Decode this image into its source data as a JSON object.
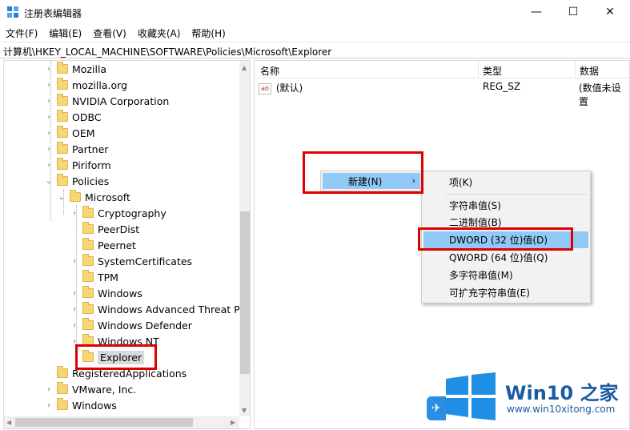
{
  "window": {
    "title": "注册表编辑器",
    "minimize_glyph": "—",
    "maximize_glyph": "☐",
    "close_glyph": "✕"
  },
  "menu": [
    "文件(F)",
    "编辑(E)",
    "查看(V)",
    "收藏夹(A)",
    "帮助(H)"
  ],
  "address": "计算机\\HKEY_LOCAL_MACHINE\\SOFTWARE\\Policies\\Microsoft\\Explorer",
  "tree": [
    {
      "label": "Mozilla",
      "level": 0,
      "expander": "collapsed"
    },
    {
      "label": "mozilla.org",
      "level": 0,
      "expander": "collapsed"
    },
    {
      "label": "NVIDIA Corporation",
      "level": 0,
      "expander": "collapsed"
    },
    {
      "label": "ODBC",
      "level": 0,
      "expander": "collapsed"
    },
    {
      "label": "OEM",
      "level": 0,
      "expander": "collapsed"
    },
    {
      "label": "Partner",
      "level": 0,
      "expander": "collapsed"
    },
    {
      "label": "Piriform",
      "level": 0,
      "expander": "collapsed"
    },
    {
      "label": "Policies",
      "level": 0,
      "expander": "expanded"
    },
    {
      "label": "Microsoft",
      "level": 1,
      "expander": "expanded"
    },
    {
      "label": "Cryptography",
      "level": 2,
      "expander": "collapsed"
    },
    {
      "label": "PeerDist",
      "level": 2,
      "expander": "none"
    },
    {
      "label": "Peernet",
      "level": 2,
      "expander": "none"
    },
    {
      "label": "SystemCertificates",
      "level": 2,
      "expander": "collapsed"
    },
    {
      "label": "TPM",
      "level": 2,
      "expander": "none"
    },
    {
      "label": "Windows",
      "level": 2,
      "expander": "collapsed"
    },
    {
      "label": "Windows Advanced Threat Pr",
      "level": 2,
      "expander": "collapsed"
    },
    {
      "label": "Windows Defender",
      "level": 2,
      "expander": "collapsed"
    },
    {
      "label": "Windows NT",
      "level": 2,
      "expander": "collapsed"
    },
    {
      "label": "Explorer",
      "level": 2,
      "expander": "none",
      "selected": true
    },
    {
      "label": "RegisteredApplications",
      "level": 0,
      "expander": "none"
    },
    {
      "label": "VMware, Inc.",
      "level": 0,
      "expander": "collapsed"
    },
    {
      "label": "Windows",
      "level": 0,
      "expander": "collapsed"
    }
  ],
  "columns": {
    "name": "名称",
    "type": "类型",
    "data": "数据"
  },
  "values": [
    {
      "icon": "ab",
      "name": "(默认)",
      "type": "REG_SZ",
      "data": "(数值未设置"
    }
  ],
  "context_menu": {
    "new_label": "新建(N)",
    "submenu_arrow": "›",
    "submenu": {
      "key": "项(K)",
      "items": [
        "字符串值(S)",
        "二进制值(B)",
        "DWORD (32 位)值(D)",
        "QWORD (64 位)值(Q)",
        "多字符串值(M)",
        "可扩充字符串值(E)"
      ],
      "highlighted": "DWORD (32 位)值(D)"
    }
  },
  "watermark": {
    "brand": "Win10 之家",
    "site": "www.win10xitong.com"
  },
  "colors": {
    "highlight": "#91c9f7",
    "annotation_red": "#e00000",
    "folder_yellow": "#f7d774",
    "watermark_blue": "#1a5aa3"
  }
}
